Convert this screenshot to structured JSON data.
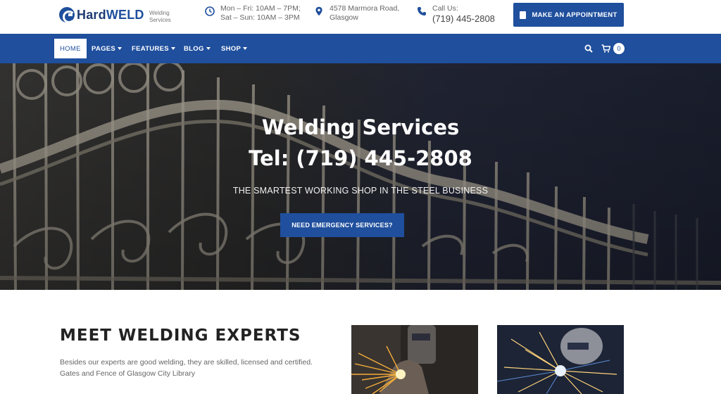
{
  "brand": {
    "name_a": "Hard",
    "name_b": "WELD",
    "tagline": "Welding Services"
  },
  "header": {
    "hours": {
      "line1": "Mon – Fri: 10AM – 7PM;",
      "line2": "Sat – Sun: 10AM – 3PM"
    },
    "address": {
      "line1": "4578 Marmora Road,",
      "line2": "Glasgow"
    },
    "phone": {
      "label": "Call Us:",
      "number": "(719) 445-2808"
    },
    "appointment_button": "MAKE AN APPOINTMENT"
  },
  "nav": {
    "items": [
      {
        "label": "HOME"
      },
      {
        "label": "PAGES"
      },
      {
        "label": "FEATURES"
      },
      {
        "label": "BLOG"
      },
      {
        "label": "SHOP"
      }
    ],
    "cart_count": "0"
  },
  "hero": {
    "title_line1": "Welding Services",
    "title_line2": "Tel: (719) 445-2808",
    "subtitle": "THE SMARTEST WORKING SHOP IN THE STEEL BUSINESS",
    "button": "NEED EMERGENCY SERVICES?"
  },
  "about": {
    "title": "MEET WELDING EXPERTS",
    "text": "Besides our experts are good welding, they are skilled, licensed  and certified. Gates and Fence of Glasgow City Library"
  },
  "colors": {
    "brand_blue": "#1f4f9d",
    "white": "#ffffff"
  },
  "icons": [
    "clock-icon",
    "location-pin-icon",
    "phone-icon",
    "calendar-icon",
    "search-icon",
    "cart-icon"
  ]
}
